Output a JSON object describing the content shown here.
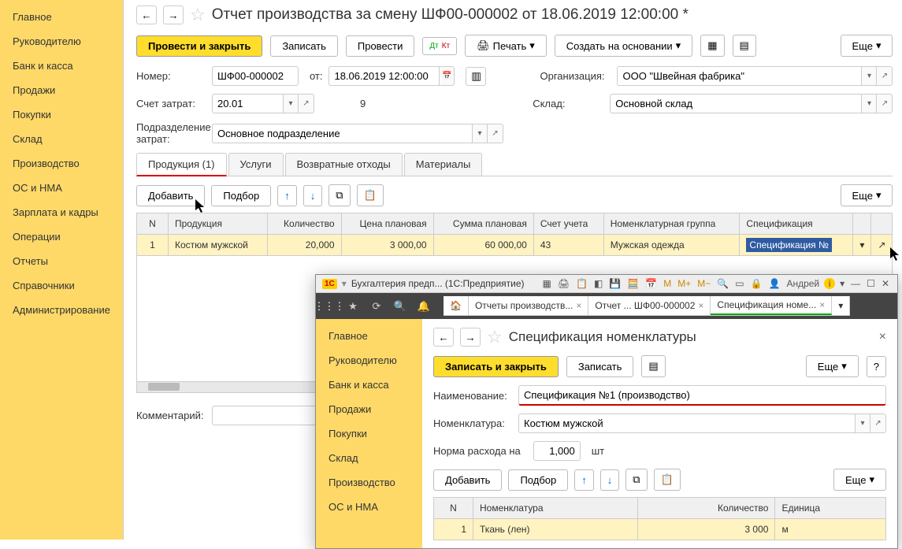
{
  "sidebar": {
    "items": [
      "Главное",
      "Руководителю",
      "Банк и касса",
      "Продажи",
      "Покупки",
      "Склад",
      "Производство",
      "ОС и НМА",
      "Зарплата и кадры",
      "Операции",
      "Отчеты",
      "Справочники",
      "Администрирование"
    ]
  },
  "header": {
    "title": "Отчет производства за смену ШФ00-000002 от 18.06.2019 12:00:00 *"
  },
  "toolbar": {
    "post_close": "Провести и закрыть",
    "save": "Записать",
    "post": "Провести",
    "print": "Печать",
    "create_based": "Создать на основании",
    "more": "Еще"
  },
  "form": {
    "number_label": "Номер:",
    "number": "ШФ00-000002",
    "from_label": "от:",
    "date": "18.06.2019 12:00:00",
    "org_label": "Организация:",
    "org": "ООО \"Швейная фабрика\"",
    "costacc_label": "Счет затрат:",
    "costacc": "20.01",
    "extra": "9",
    "warehouse_label": "Склад:",
    "warehouse": "Основной склад",
    "division_label": "Подразделение затрат:",
    "division": "Основное подразделение",
    "comment_label": "Комментарий:"
  },
  "tabs": {
    "t1": "Продукция (1)",
    "t2": "Услуги",
    "t3": "Возвратные отходы",
    "t4": "Материалы"
  },
  "tabtoolbar": {
    "add": "Добавить",
    "pick": "Подбор",
    "more": "Еще"
  },
  "grid": {
    "headers": {
      "n": "N",
      "prod": "Продукция",
      "qty": "Количество",
      "price": "Цена плановая",
      "sum": "Сумма плановая",
      "acc": "Счет учета",
      "nomgrp": "Номенклатурная группа",
      "spec": "Спецификация"
    },
    "rows": [
      {
        "n": "1",
        "prod": "Костюм мужской",
        "qty": "20,000",
        "price": "3 000,00",
        "sum": "60 000,00",
        "acc": "43",
        "nomgrp": "Мужская одежда",
        "spec": "Спецификация №"
      }
    ]
  },
  "sub": {
    "app_title": "Бухгалтерия предп... (1С:Предприятие)",
    "user": "Андрей",
    "wtabs": {
      "t1": "Отчеты производств...",
      "t2": "Отчет ... ШФ00-000002",
      "t3": "Спецификация номе..."
    },
    "sidebar": [
      "Главное",
      "Руководителю",
      "Банк и касса",
      "Продажи",
      "Покупки",
      "Склад",
      "Производство",
      "ОС и НМА"
    ],
    "title": "Спецификация номенклатуры",
    "toolbar": {
      "save_close": "Записать и закрыть",
      "save": "Записать",
      "more": "Еще",
      "help": "?"
    },
    "form": {
      "name_label": "Наименование:",
      "name": "Спецификация №1 (производство)",
      "nom_label": "Номенклатура:",
      "nom": "Костюм мужской",
      "norm_label": "Норма расхода на",
      "norm": "1,000",
      "norm_unit": "шт"
    },
    "tabtoolbar": {
      "add": "Добавить",
      "pick": "Подбор",
      "more": "Еще"
    },
    "grid": {
      "headers": {
        "n": "N",
        "nom": "Номенклатура",
        "qty": "Количество",
        "unit": "Единица"
      },
      "rows": [
        {
          "n": "1",
          "nom": "Ткань (лен)",
          "qty": "3 000",
          "unit": "м"
        }
      ]
    }
  }
}
